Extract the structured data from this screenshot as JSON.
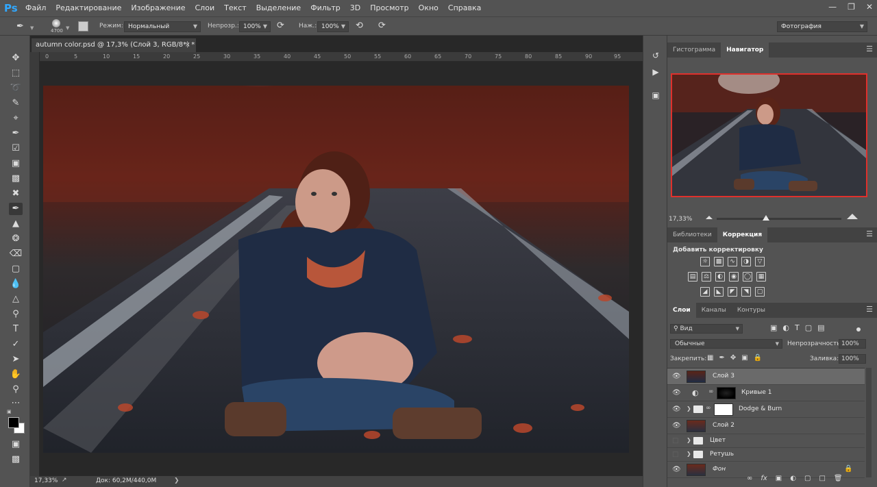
{
  "app": {
    "logo": "Ps"
  },
  "menu": [
    "Файл",
    "Редактирование",
    "Изображение",
    "Слои",
    "Текст",
    "Выделение",
    "Фильтр",
    "3D",
    "Просмотр",
    "Окно",
    "Справка"
  ],
  "options": {
    "brush_size": "4700",
    "mode_label": "Режим:",
    "mode_value": "Нормальный",
    "opacity_label": "Непрозр.:",
    "opacity_value": "100%",
    "flow_label": "Наж.:",
    "flow_value": "100%",
    "workspace": "Фотография"
  },
  "document": {
    "tab_title": "autumn color.psd @ 17,3% (Слой 3, RGB/8*) *",
    "close": "×",
    "ruler_ticks": [
      "0",
      "5",
      "10",
      "15",
      "20",
      "25",
      "30",
      "35",
      "40",
      "45",
      "50",
      "55",
      "60",
      "65",
      "70",
      "75",
      "80",
      "85",
      "90",
      "95"
    ],
    "status_zoom": "17,33%",
    "status_doc": "Док: 60,2M/440,0M"
  },
  "navigator": {
    "tabs": [
      "Гистограмма",
      "Навигатор"
    ],
    "zoom": "17,33%"
  },
  "adjustments": {
    "tabs": [
      "Библиотеки",
      "Коррекция"
    ],
    "heading": "Добавить корректировку"
  },
  "layers": {
    "tabs": [
      "Слои",
      "Каналы",
      "Контуры"
    ],
    "filter": "Вид",
    "blend": "Обычные",
    "opacity_label": "Непрозрачность:",
    "opacity_value": "100%",
    "lock_label": "Закрепить:",
    "fill_label": "Заливка:",
    "fill_value": "100%",
    "items": [
      {
        "name": "Слой 3",
        "visible": true,
        "selected": true
      },
      {
        "name": "Кривые 1",
        "visible": true
      },
      {
        "name": "Dodge & Burn",
        "visible": true
      },
      {
        "name": "Слой 2",
        "visible": true
      },
      {
        "name": "Цвет",
        "visible": false
      },
      {
        "name": "Ретушь",
        "visible": false
      },
      {
        "name": "Фон",
        "visible": true
      }
    ]
  },
  "colors": {
    "accent": "#e0302c",
    "ps_blue": "#31a8ff"
  }
}
